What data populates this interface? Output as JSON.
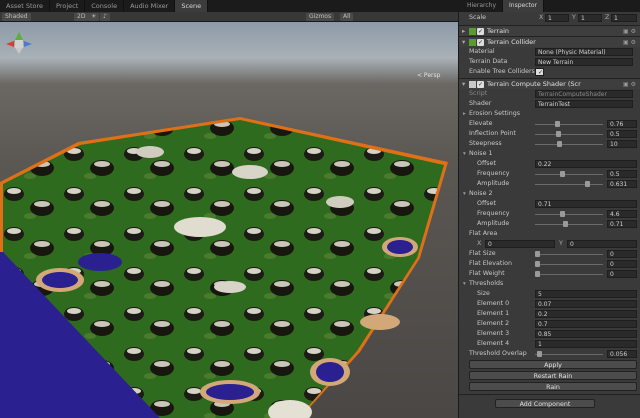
{
  "scene_tabs": [
    {
      "label": "Asset Store",
      "active": false
    },
    {
      "label": "Project",
      "active": false
    },
    {
      "label": "Console",
      "active": false
    },
    {
      "label": "Audio Mixer",
      "active": false
    },
    {
      "label": "Scene",
      "active": true
    }
  ],
  "scene_toolbar": {
    "shading": "Shaded",
    "mode": "2D",
    "gizmos": "Gizmos",
    "search": "All"
  },
  "scene": {
    "persp_label": "< Persp"
  },
  "inspector": {
    "tabs": [
      "Hierarchy",
      "Inspector"
    ],
    "scale_label": "Scale",
    "scale": {
      "x_label": "X",
      "x": "1",
      "y_label": "Y",
      "y": "1",
      "z_label": "Z",
      "z": "1"
    },
    "terrain": {
      "name": "Terrain"
    },
    "collider": {
      "name": "Terrain Collider",
      "material_label": "Material",
      "material_value": "None (Physic Material)",
      "data_label": "Terrain Data",
      "data_value": "New Terrain",
      "tree_label": "Enable Tree Colliders"
    },
    "shader_comp": {
      "name": "Terrain Compute Shader (Scr",
      "script_label": "Script",
      "script_value": "TerrainComputeShader",
      "shader_label": "Shader",
      "shader_value": "TerrainTest"
    },
    "erosion_settings": "Erosion Settings",
    "params": [
      {
        "label": "Elevate",
        "value": "0.76",
        "pos": 0.32
      },
      {
        "label": "Inflection Point",
        "value": "0.5",
        "pos": 0.34
      },
      {
        "label": "Steepness",
        "value": "10",
        "pos": 0.35
      }
    ],
    "noise1": {
      "title": "Noise 1",
      "offset_label": "Offset",
      "offset_value": "0.22",
      "frequency_label": "Frequency",
      "frequency_value": "0.5",
      "frequency_pos": 0.4,
      "amplitude_label": "Amplitude",
      "amplitude_value": "0.631",
      "amplitude_pos": 0.8
    },
    "noise2": {
      "title": "Noise 2",
      "offset_label": "Offset",
      "offset_value": "0.71",
      "frequency_label": "Frequency",
      "frequency_value": "4.6",
      "frequency_pos": 0.4,
      "amplitude_label": "Amplitude",
      "amplitude_value": "0.71",
      "amplitude_pos": 0.45
    },
    "flat_area": {
      "title": "Flat Area",
      "x_label": "X",
      "x": "0",
      "y_label": "Y",
      "y": "0"
    },
    "flat_params": [
      {
        "label": "Flat Size",
        "value": "0",
        "pos": 0.0
      },
      {
        "label": "Flat Elevation",
        "value": "0",
        "pos": 0.0
      },
      {
        "label": "Flat Weight",
        "value": "0",
        "pos": 0.0
      }
    ],
    "thresholds": {
      "title": "Thresholds",
      "size_label": "Size",
      "size_value": "5",
      "elements": [
        {
          "label": "Element 0",
          "value": "0.07"
        },
        {
          "label": "Element 1",
          "value": "0.2"
        },
        {
          "label": "Element 2",
          "value": "0.7"
        },
        {
          "label": "Element 3",
          "value": "0.85"
        },
        {
          "label": "Element 4",
          "value": "1"
        }
      ]
    },
    "threshold_overlap": {
      "label": "Threshold Overlap",
      "value": "0.056",
      "pos": 0.03
    },
    "buttons": {
      "apply": "Apply",
      "restart": "Restart Rain",
      "rain": "Rain"
    },
    "add_component": "Add Component"
  },
  "colors": {
    "panel": "#3a3a3a",
    "field": "#2a2a2a",
    "terrain_green": "#2f6b1e",
    "terrain_water": "#2a2090",
    "terrain_sand": "#d2a878",
    "terrain_rock": "#1a1a14",
    "terrain_snow": "#d8d4c8",
    "selection_outline": "#e07018"
  }
}
